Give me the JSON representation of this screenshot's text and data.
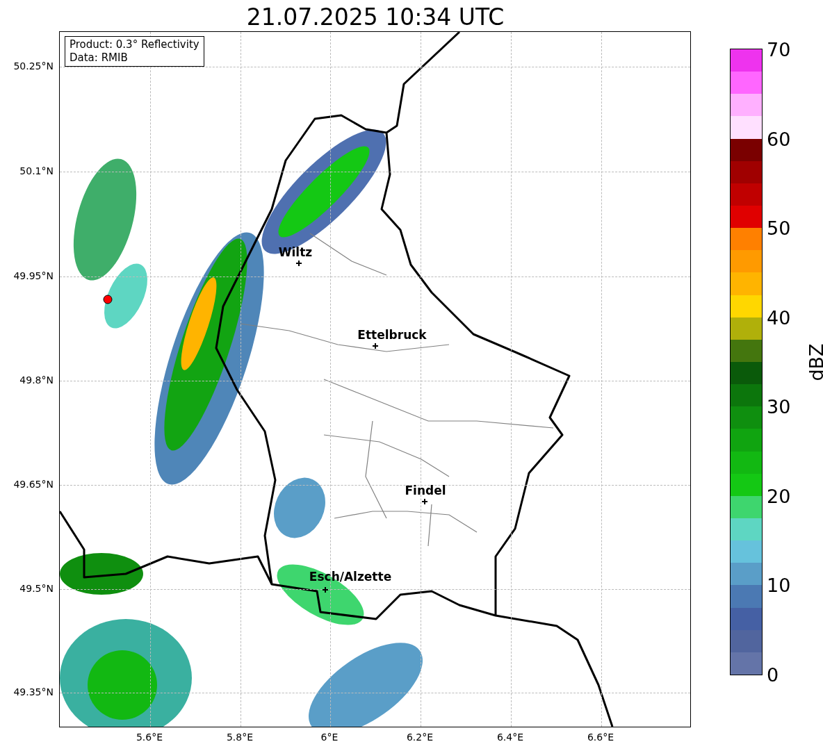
{
  "title": "21.07.2025 10:34 UTC",
  "info_box": [
    "Product: 0.3° Reflectivity",
    "Data: RMIB"
  ],
  "y_ticks": [
    "50.25°N",
    "50.1°N",
    "49.95°N",
    "49.8°N",
    "49.65°N",
    "49.5°N",
    "49.35°N"
  ],
  "x_ticks": [
    "5.6°E",
    "5.8°E",
    "6°E",
    "6.2°E",
    "6.4°E",
    "6.6°E"
  ],
  "places": [
    {
      "name": "Wiltz"
    },
    {
      "name": "Ettelbruck"
    },
    {
      "name": "Findel"
    },
    {
      "name": "Esch/Alzette"
    }
  ],
  "colorbar": {
    "label": "dBZ",
    "ticks": [
      "70",
      "60",
      "50",
      "40",
      "30",
      "20",
      "10",
      "0"
    ],
    "bins": [
      {
        "color": "#ee33ee"
      },
      {
        "color": "#ff66ff"
      },
      {
        "color": "#ffb0ff"
      },
      {
        "color": "#ffe0ff"
      },
      {
        "color": "#7a0000"
      },
      {
        "color": "#a00000"
      },
      {
        "color": "#c00000"
      },
      {
        "color": "#e00000"
      },
      {
        "color": "#ff8000"
      },
      {
        "color": "#ff9a00"
      },
      {
        "color": "#ffb400"
      },
      {
        "color": "#ffd700"
      },
      {
        "color": "#b0b00a"
      },
      {
        "color": "#44760e"
      },
      {
        "color": "#0a5a0a"
      },
      {
        "color": "#0c760c"
      },
      {
        "color": "#0f8f0f"
      },
      {
        "color": "#10a410"
      },
      {
        "color": "#12b812"
      },
      {
        "color": "#14c814"
      },
      {
        "color": "#3ed66e"
      },
      {
        "color": "#5ed6c2"
      },
      {
        "color": "#66c2dc"
      },
      {
        "color": "#5a9ec8"
      },
      {
        "color": "#4b79b3"
      },
      {
        "color": "#4560a4"
      },
      {
        "color": "#51659e"
      },
      {
        "color": "#6474a8"
      }
    ]
  }
}
